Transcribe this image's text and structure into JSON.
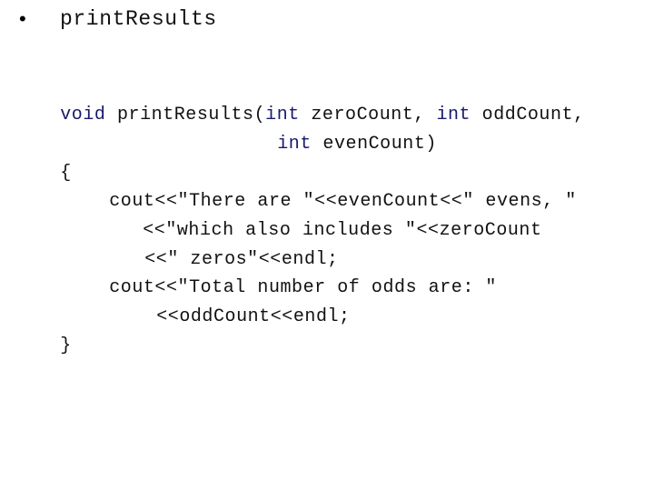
{
  "slide": {
    "bullet_glyph": "•",
    "heading": "printResults"
  },
  "code": {
    "keyword_color": "#1a1a6e",
    "text_color": "#111111",
    "lines": [
      {
        "segments": [
          {
            "text": "void",
            "kw": true
          },
          {
            "text": " printResults(",
            "kw": false
          },
          {
            "text": "int",
            "kw": true
          },
          {
            "text": " zeroCount, ",
            "kw": false
          },
          {
            "text": "int",
            "kw": true
          },
          {
            "text": " oddCount,",
            "kw": false
          }
        ]
      },
      {
        "segments": [
          {
            "text": "int",
            "kw": true
          },
          {
            "text": " evenCount)",
            "kw": false
          }
        ]
      },
      {
        "segments": [
          {
            "text": "{",
            "kw": false
          }
        ]
      },
      {
        "segments": [
          {
            "text": "cout<<\"There are \"<<evenCount<<\" evens, \"",
            "kw": false
          }
        ]
      },
      {
        "segments": [
          {
            "text": "<<\"which also includes \"<<zeroCount",
            "kw": false
          }
        ]
      },
      {
        "segments": [
          {
            "text": "<<\" zeros\"<<endl;",
            "kw": false
          }
        ]
      },
      {
        "segments": [
          {
            "text": "cout<<\"Total number of odds are: \"",
            "kw": false
          }
        ]
      },
      {
        "segments": [
          {
            "text": "<<oddCount<<endl;",
            "kw": false
          }
        ]
      },
      {
        "segments": [
          {
            "text": "}",
            "kw": false
          }
        ]
      }
    ]
  }
}
